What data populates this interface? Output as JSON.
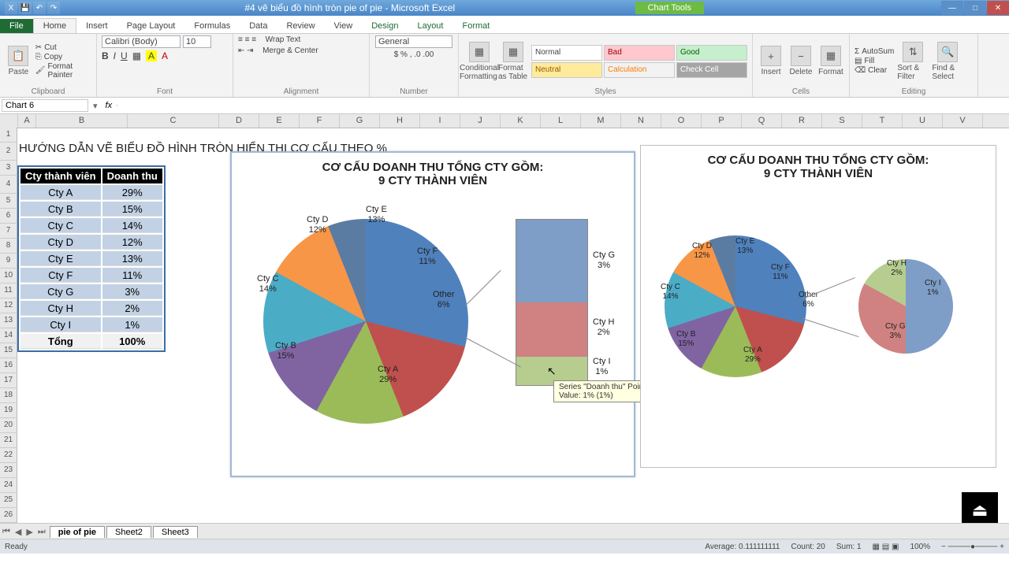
{
  "app": {
    "title": "#4 vẽ biểu đồ hình tròn pie of pie - Microsoft Excel",
    "chart_tools": "Chart Tools"
  },
  "tabs": {
    "file": "File",
    "home": "Home",
    "insert": "Insert",
    "pagelayout": "Page Layout",
    "formulas": "Formulas",
    "data": "Data",
    "review": "Review",
    "view": "View",
    "design": "Design",
    "layout": "Layout",
    "format": "Format"
  },
  "ribbon": {
    "clipboard": {
      "label": "Clipboard",
      "paste": "Paste",
      "cut": "Cut",
      "copy": "Copy",
      "painter": "Format Painter"
    },
    "font": {
      "label": "Font",
      "name": "Calibri (Body)",
      "size": "10"
    },
    "alignment": {
      "label": "Alignment",
      "wrap": "Wrap Text",
      "merge": "Merge & Center"
    },
    "number": {
      "label": "Number",
      "format": "General"
    },
    "styles": {
      "label": "Styles",
      "cond": "Conditional Formatting",
      "astable": "Format as Table",
      "normal": "Normal",
      "bad": "Bad",
      "good": "Good",
      "neutral": "Neutral",
      "calc": "Calculation",
      "check": "Check Cell"
    },
    "cells": {
      "label": "Cells",
      "insert": "Insert",
      "delete": "Delete",
      "format": "Format"
    },
    "editing": {
      "label": "Editing",
      "autosum": "AutoSum",
      "fill": "Fill",
      "clear": "Clear",
      "sort": "Sort & Filter",
      "find": "Find & Select"
    }
  },
  "namebox": "Chart 6",
  "fx_label": "fx",
  "page_heading": "HƯỚNG DẪN VẼ BIỂU ĐỒ HÌNH TRÒN HIỂN THỊ CƠ CẤU THEO %",
  "table": {
    "headers": [
      "Cty thành viên",
      "Doanh thu"
    ],
    "rows": [
      [
        "Cty A",
        "29%"
      ],
      [
        "Cty B",
        "15%"
      ],
      [
        "Cty C",
        "14%"
      ],
      [
        "Cty D",
        "12%"
      ],
      [
        "Cty E",
        "13%"
      ],
      [
        "Cty F",
        "11%"
      ],
      [
        "Cty G",
        "3%"
      ],
      [
        "Cty H",
        "2%"
      ],
      [
        "Cty I",
        "1%"
      ]
    ],
    "total": [
      "Tổng",
      "100%"
    ]
  },
  "chart_title_l1": "CƠ CẤU DOANH THU TỔNG CTY GỒM:",
  "chart_title_l2": "9 CTY THÀNH VIÊN",
  "labels": {
    "ctya": "Cty A\n29%",
    "ctyb": "Cty B\n15%",
    "ctyc": "Cty C\n14%",
    "ctyd": "Cty D\n12%",
    "ctye": "Cty E\n13%",
    "ctyf": "Cty F\n11%",
    "other": "Other\n6%",
    "ctyg": "Cty G\n3%",
    "ctyh": "Cty H\n2%",
    "ctyi": "Cty I\n1%"
  },
  "tooltip": {
    "l1": "Series \"Doanh thu\" Point \"Cty I\"",
    "l2": "Value: 1% (1%)"
  },
  "sheets": {
    "s1": "pie of pie",
    "s2": "Sheet2",
    "s3": "Sheet3"
  },
  "status": {
    "ready": "Ready",
    "avg": "Average: 0.111111111",
    "count": "Count: 20",
    "sum": "Sum: 1",
    "zoom": "100%"
  },
  "columns": [
    "A",
    "B",
    "C",
    "D",
    "E",
    "F",
    "G",
    "H",
    "I",
    "J",
    "K",
    "L",
    "M",
    "N",
    "O",
    "P",
    "Q",
    "R",
    "S",
    "T",
    "U",
    "V"
  ],
  "colors": {
    "a": "#4f81bd",
    "b": "#c0504d",
    "c": "#9bbb59",
    "d": "#8064a2",
    "e": "#4bacc6",
    "f": "#f79646",
    "other": "#5a7ca3",
    "g": "#7e9dc7",
    "h": "#cf8281",
    "i": "#b6cd8f"
  },
  "chart_data": [
    {
      "type": "pie",
      "title": "CƠ CẤU DOANH THU TỔNG CTY GỒM: 9 CTY THÀNH VIÊN",
      "subtype": "pie-of-pie (secondary as bar)",
      "primary": {
        "categories": [
          "Cty A",
          "Cty B",
          "Cty C",
          "Cty D",
          "Cty E",
          "Cty F",
          "Other"
        ],
        "values": [
          29,
          15,
          14,
          12,
          13,
          11,
          6
        ]
      },
      "secondary": {
        "of": "Other",
        "categories": [
          "Cty G",
          "Cty H",
          "Cty I"
        ],
        "values": [
          3,
          2,
          1
        ]
      },
      "unit": "%"
    },
    {
      "type": "pie",
      "title": "CƠ CẤU DOANH THU TỔNG CTY GỒM: 9 CTY THÀNH VIÊN",
      "subtype": "pie-of-pie (secondary as pie)",
      "primary": {
        "categories": [
          "Cty A",
          "Cty B",
          "Cty C",
          "Cty D",
          "Cty E",
          "Cty F",
          "Other"
        ],
        "values": [
          29,
          15,
          14,
          12,
          13,
          11,
          6
        ]
      },
      "secondary": {
        "of": "Other",
        "categories": [
          "Cty G",
          "Cty H",
          "Cty I"
        ],
        "values": [
          3,
          2,
          1
        ]
      },
      "unit": "%"
    }
  ]
}
